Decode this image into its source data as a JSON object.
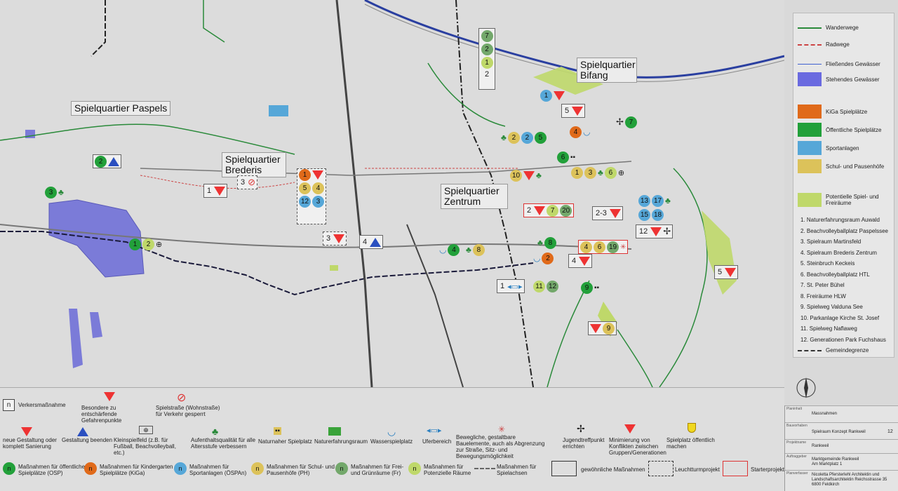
{
  "quarters": {
    "paspels": "Spielquartier Paspels",
    "brederis": "Spielquartier Brederis",
    "zentrum": "Spielquartier Zentrum",
    "bifang": "Spielquartier Bifang"
  },
  "markers": {
    "m_paspels_2": "2",
    "m_paspels_3": "3",
    "m_paspels_1": "1",
    "m_paspels_2b": "2",
    "m_bred_1": "1",
    "m_bred_3": "3",
    "m_bred_stack": [
      "1",
      "5",
      "4",
      "12",
      "3"
    ],
    "m_bred_3b": "3",
    "m_bred_4": "4",
    "m_top_stack": [
      "7",
      "2",
      "1",
      "2"
    ],
    "m_b1": "1",
    "m_b5": "5",
    "m_b7": "7",
    "m_b4": "4",
    "m_z_row": [
      "2",
      "2",
      "5"
    ],
    "m_z6": "6",
    "m_z_row2": [
      "1",
      "3",
      "6"
    ],
    "m_z10": "10",
    "m_z13": [
      "13",
      "17"
    ],
    "m_z15": [
      "15",
      "18"
    ],
    "m_z2": [
      "2",
      "7",
      "20"
    ],
    "m_z23": "2-3",
    "m_z12": "12",
    "m_z8": "8",
    "m_z4b": "4",
    "m_z_row3": [
      "4",
      "6",
      "19"
    ],
    "m_z2b": "2",
    "m_z4c": "4",
    "m_z1": "1",
    "m_z11": [
      "11",
      "12"
    ],
    "m_z9": "9",
    "m_z9b": "9",
    "m_z5": "5",
    "m_b8": "8"
  },
  "legend": {
    "wanderwege": "Wanderwege",
    "radwege": "Radwege",
    "fliess": "Fließendes Gewässer",
    "stehend": "Stehendes Gewässer",
    "kiga": "KiGa Spielplätze",
    "osp": "Öffentliche Spielplätze",
    "sport": "Sportanlagen",
    "schul": "Schul- und Pausenhöfe",
    "pot": "Potentielle Spiel- und Freiräume",
    "list": [
      "1. Naturerfahrungsraum Auwald",
      "2. Beachvolleyballplatz Paspelssee",
      "3. Spielraum Martinsfeld",
      "4. Spielraum Brederis Zentrum",
      "5. Steinbruch Keckeis",
      "6. Beachvolleyballplatz HTL",
      "7. St. Peter Bühel",
      "8. Freiräume HLW",
      "9. Spielweg Valduna See",
      "10. Parkanlage Kirche St. Josef",
      "11. Spielweg Naflaweg",
      "12. Generationen Park Fuchshaus"
    ],
    "gemeinde": "Gemeindegrenze",
    "colors": {
      "osp": "#22a03a",
      "kiga": "#e06a1a",
      "sport": "#56a7d8",
      "schul": "#dcc25a",
      "pot": "#bfd86a",
      "water": "#6a6ae0"
    }
  },
  "bottom": {
    "n": "n",
    "verkehr": "Verkersmaßnahme",
    "gefahr": "Besondere zu entschärfende Gefahrenpunkte",
    "spielstrasse": "Spielstraße (Wohnstraße) für Verkehr gesperrt",
    "neu": "neue Gestaltung oder komplett Sanierung",
    "beenden": "Gestaltung beenden",
    "klein": "Kleinspielfeld (z.B. für Fußball, Beachvolleyball, etc.)",
    "aufenthalt": "Aufenthaltsqualität für alle Altersstufe verbessern",
    "naturnah": "Naturnaher Spielplatz",
    "naturerf": "Naturerfahrungsraum",
    "wasser": "Wasserspielplatz",
    "ufer": "Uferbereich",
    "beweglich": "Bewegliche, gestaltbare Bauelemente, auch als Abgrenzung zur Straße, Sitz- und Bewegungsmöglichkeit",
    "jugend": "Jugendtreffpunkt errichten",
    "minimierung": "Minimierung von Konflikten zwischen Gruppen/Generationen",
    "oeffentlich": "Spielplatz öffentlich machen",
    "m_osp": "Maßnahmen für öffentliche Spielplätze (OSP)",
    "m_kiga": "Maßnahmen für Kindergarten Spielplätze (KiGa)",
    "m_sport": "Maßnahmen für Sportanlagen (ÖSPAn)",
    "m_schul": "Maßnahmen für Schul- und Pausenhöfe (PH)",
    "m_frei": "Maßnahmen für Frei- und Grünräume (Fr)",
    "m_pot": "Maßnahmen für Potenzielle Räume",
    "m_achsen": "Maßnahmen für Spielachsen",
    "gewoehnlich": "gewöhnliche Maßnahmen",
    "leucht": "Leuchtturmprojekt",
    "starter": "Starterprojekt"
  },
  "titleblock": {
    "k1": "Planinhalt",
    "v1": "Massnahmen",
    "k2": "Bauvorhaben",
    "v2": "Spielraum Konzept Rankweil",
    "k3": "Projektname",
    "v3": "Rankweil",
    "k4": "Auftraggeber",
    "v4a": "Marktgemeinde Rankweil",
    "v4b": "Am Marktplatz 1",
    "k5": "Planverfasser",
    "v5a": "Nicoletta Pfersterlehl Architektin und",
    "v5b": "Landschaftsarchitektin Reichsstrasse 35",
    "v5c": "6800 Feldkirch",
    "page": "12"
  }
}
